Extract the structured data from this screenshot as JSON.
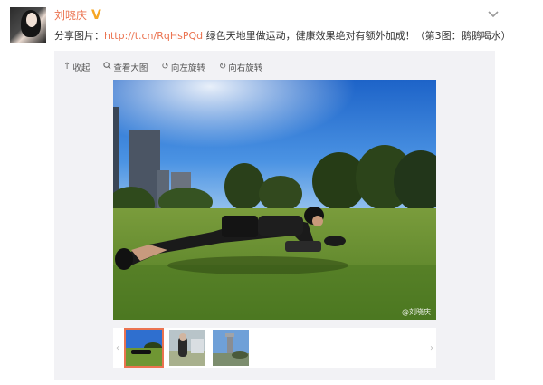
{
  "post": {
    "username": "刘晓庆",
    "verified_badge": "V",
    "text_prefix": "分享图片：",
    "link": "http://t.cn/RqHsPQd",
    "text_body": " 绿色天地里做运动，健康效果绝对有额外加成！（第3图：鹅鹅喝水）"
  },
  "toolbar": {
    "collapse_label": "收起",
    "view_large_label": "查看大图",
    "rotate_left_label": "向左旋转",
    "rotate_right_label": "向右旋转"
  },
  "photo": {
    "watermark": "@刘晓庆"
  },
  "thumbnails": {
    "selected_index": 0,
    "count": 3
  },
  "colors": {
    "brand": "#eb7350",
    "verified": "#f6a623",
    "media_bg": "#f2f2f5"
  },
  "icons": [
    "chevron-down-icon",
    "collapse-icon",
    "search-icon",
    "rotate-left-icon",
    "rotate-right-icon"
  ]
}
